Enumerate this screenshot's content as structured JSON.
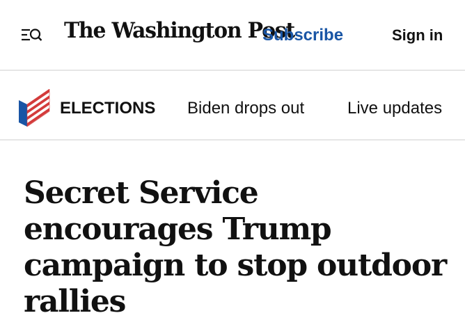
{
  "header": {
    "masthead": "The Washington Post",
    "subscribe_label": "Subscribe",
    "signin_label": "Sign in",
    "menu_icon": "menu-search-icon"
  },
  "nav": {
    "section_icon": "election-flag-icon",
    "section_label": "ELECTIONS",
    "links": [
      {
        "label": "Biden drops out"
      },
      {
        "label": "Live updates"
      }
    ]
  },
  "article": {
    "headline": "Secret Service encourages Trump campaign to stop outdoor rallies"
  },
  "colors": {
    "brand_blue": "#1955a5",
    "flag_red": "#d33b3b",
    "text": "#111111",
    "divider": "#e6e6e6"
  }
}
